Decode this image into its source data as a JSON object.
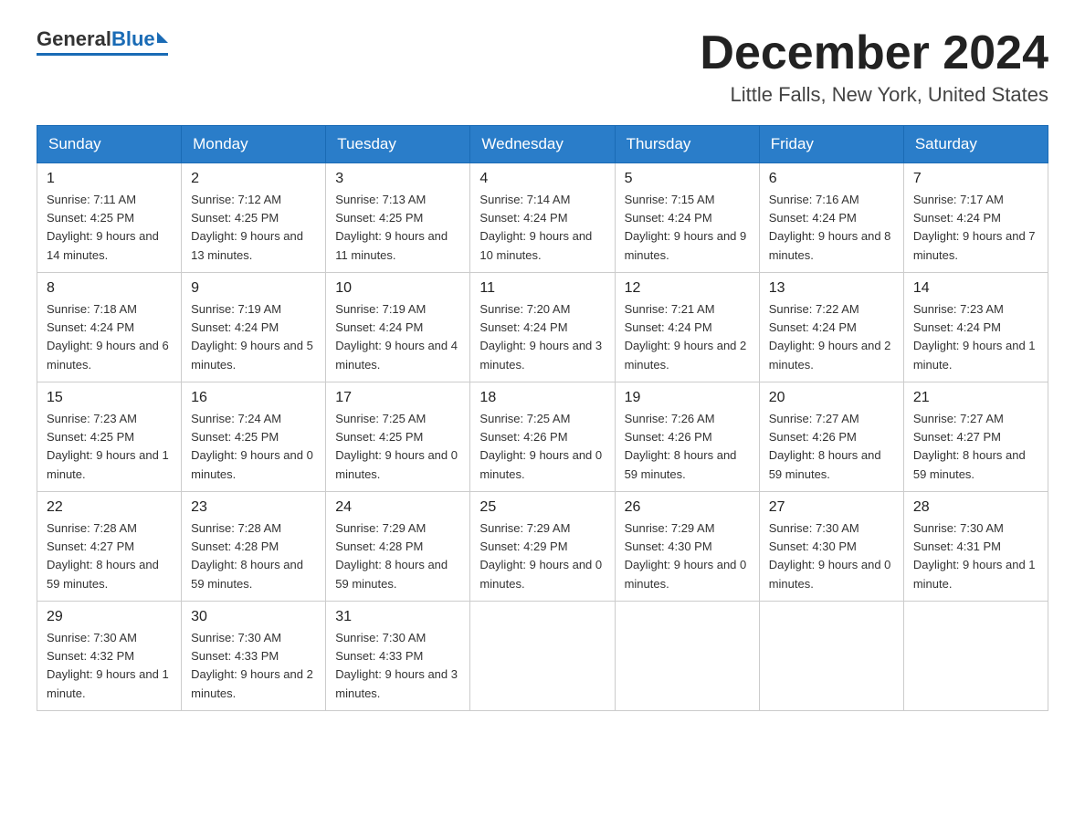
{
  "header": {
    "logo_general": "General",
    "logo_blue": "Blue",
    "month_title": "December 2024",
    "location": "Little Falls, New York, United States"
  },
  "days_of_week": [
    "Sunday",
    "Monday",
    "Tuesday",
    "Wednesday",
    "Thursday",
    "Friday",
    "Saturday"
  ],
  "weeks": [
    [
      {
        "day": "1",
        "sunrise": "7:11 AM",
        "sunset": "4:25 PM",
        "daylight": "9 hours and 14 minutes."
      },
      {
        "day": "2",
        "sunrise": "7:12 AM",
        "sunset": "4:25 PM",
        "daylight": "9 hours and 13 minutes."
      },
      {
        "day": "3",
        "sunrise": "7:13 AM",
        "sunset": "4:25 PM",
        "daylight": "9 hours and 11 minutes."
      },
      {
        "day": "4",
        "sunrise": "7:14 AM",
        "sunset": "4:24 PM",
        "daylight": "9 hours and 10 minutes."
      },
      {
        "day": "5",
        "sunrise": "7:15 AM",
        "sunset": "4:24 PM",
        "daylight": "9 hours and 9 minutes."
      },
      {
        "day": "6",
        "sunrise": "7:16 AM",
        "sunset": "4:24 PM",
        "daylight": "9 hours and 8 minutes."
      },
      {
        "day": "7",
        "sunrise": "7:17 AM",
        "sunset": "4:24 PM",
        "daylight": "9 hours and 7 minutes."
      }
    ],
    [
      {
        "day": "8",
        "sunrise": "7:18 AM",
        "sunset": "4:24 PM",
        "daylight": "9 hours and 6 minutes."
      },
      {
        "day": "9",
        "sunrise": "7:19 AM",
        "sunset": "4:24 PM",
        "daylight": "9 hours and 5 minutes."
      },
      {
        "day": "10",
        "sunrise": "7:19 AM",
        "sunset": "4:24 PM",
        "daylight": "9 hours and 4 minutes."
      },
      {
        "day": "11",
        "sunrise": "7:20 AM",
        "sunset": "4:24 PM",
        "daylight": "9 hours and 3 minutes."
      },
      {
        "day": "12",
        "sunrise": "7:21 AM",
        "sunset": "4:24 PM",
        "daylight": "9 hours and 2 minutes."
      },
      {
        "day": "13",
        "sunrise": "7:22 AM",
        "sunset": "4:24 PM",
        "daylight": "9 hours and 2 minutes."
      },
      {
        "day": "14",
        "sunrise": "7:23 AM",
        "sunset": "4:24 PM",
        "daylight": "9 hours and 1 minute."
      }
    ],
    [
      {
        "day": "15",
        "sunrise": "7:23 AM",
        "sunset": "4:25 PM",
        "daylight": "9 hours and 1 minute."
      },
      {
        "day": "16",
        "sunrise": "7:24 AM",
        "sunset": "4:25 PM",
        "daylight": "9 hours and 0 minutes."
      },
      {
        "day": "17",
        "sunrise": "7:25 AM",
        "sunset": "4:25 PM",
        "daylight": "9 hours and 0 minutes."
      },
      {
        "day": "18",
        "sunrise": "7:25 AM",
        "sunset": "4:26 PM",
        "daylight": "9 hours and 0 minutes."
      },
      {
        "day": "19",
        "sunrise": "7:26 AM",
        "sunset": "4:26 PM",
        "daylight": "8 hours and 59 minutes."
      },
      {
        "day": "20",
        "sunrise": "7:27 AM",
        "sunset": "4:26 PM",
        "daylight": "8 hours and 59 minutes."
      },
      {
        "day": "21",
        "sunrise": "7:27 AM",
        "sunset": "4:27 PM",
        "daylight": "8 hours and 59 minutes."
      }
    ],
    [
      {
        "day": "22",
        "sunrise": "7:28 AM",
        "sunset": "4:27 PM",
        "daylight": "8 hours and 59 minutes."
      },
      {
        "day": "23",
        "sunrise": "7:28 AM",
        "sunset": "4:28 PM",
        "daylight": "8 hours and 59 minutes."
      },
      {
        "day": "24",
        "sunrise": "7:29 AM",
        "sunset": "4:28 PM",
        "daylight": "8 hours and 59 minutes."
      },
      {
        "day": "25",
        "sunrise": "7:29 AM",
        "sunset": "4:29 PM",
        "daylight": "9 hours and 0 minutes."
      },
      {
        "day": "26",
        "sunrise": "7:29 AM",
        "sunset": "4:30 PM",
        "daylight": "9 hours and 0 minutes."
      },
      {
        "day": "27",
        "sunrise": "7:30 AM",
        "sunset": "4:30 PM",
        "daylight": "9 hours and 0 minutes."
      },
      {
        "day": "28",
        "sunrise": "7:30 AM",
        "sunset": "4:31 PM",
        "daylight": "9 hours and 1 minute."
      }
    ],
    [
      {
        "day": "29",
        "sunrise": "7:30 AM",
        "sunset": "4:32 PM",
        "daylight": "9 hours and 1 minute."
      },
      {
        "day": "30",
        "sunrise": "7:30 AM",
        "sunset": "4:33 PM",
        "daylight": "9 hours and 2 minutes."
      },
      {
        "day": "31",
        "sunrise": "7:30 AM",
        "sunset": "4:33 PM",
        "daylight": "9 hours and 3 minutes."
      },
      null,
      null,
      null,
      null
    ]
  ],
  "labels": {
    "sunrise": "Sunrise:",
    "sunset": "Sunset:",
    "daylight": "Daylight:"
  }
}
